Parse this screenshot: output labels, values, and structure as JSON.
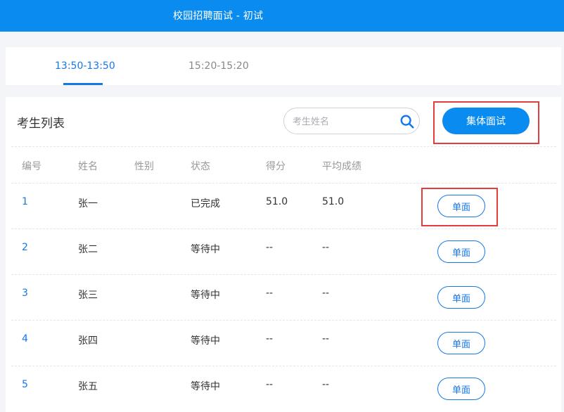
{
  "header": {
    "title": "校园招聘面试 - 初试"
  },
  "tabs": [
    {
      "label": "13:50-13:50",
      "active": true
    },
    {
      "label": "15:20-15:20",
      "active": false
    }
  ],
  "panel": {
    "title": "考生列表",
    "search": {
      "placeholder": "考生姓名",
      "icon": "search-icon"
    },
    "group_button": "集体面试"
  },
  "table": {
    "columns": [
      "编号",
      "姓名",
      "性别",
      "状态",
      "得分",
      "平均成绩"
    ],
    "rows": [
      {
        "id": "1",
        "name": "张一",
        "gender": "",
        "status": "已完成",
        "score": "51.0",
        "avg": "51.0",
        "action": "单面"
      },
      {
        "id": "2",
        "name": "张二",
        "gender": "",
        "status": "等待中",
        "score": "--",
        "avg": "--",
        "action": "单面"
      },
      {
        "id": "3",
        "name": "张三",
        "gender": "",
        "status": "等待中",
        "score": "--",
        "avg": "--",
        "action": "单面"
      },
      {
        "id": "4",
        "name": "张四",
        "gender": "",
        "status": "等待中",
        "score": "--",
        "avg": "--",
        "action": "单面"
      },
      {
        "id": "5",
        "name": "张五",
        "gender": "",
        "status": "等待中",
        "score": "--",
        "avg": "--",
        "action": "单面"
      }
    ]
  },
  "colors": {
    "accent": "#0a8bf0",
    "link": "#1677e8",
    "highlight": "#e33d3d"
  }
}
